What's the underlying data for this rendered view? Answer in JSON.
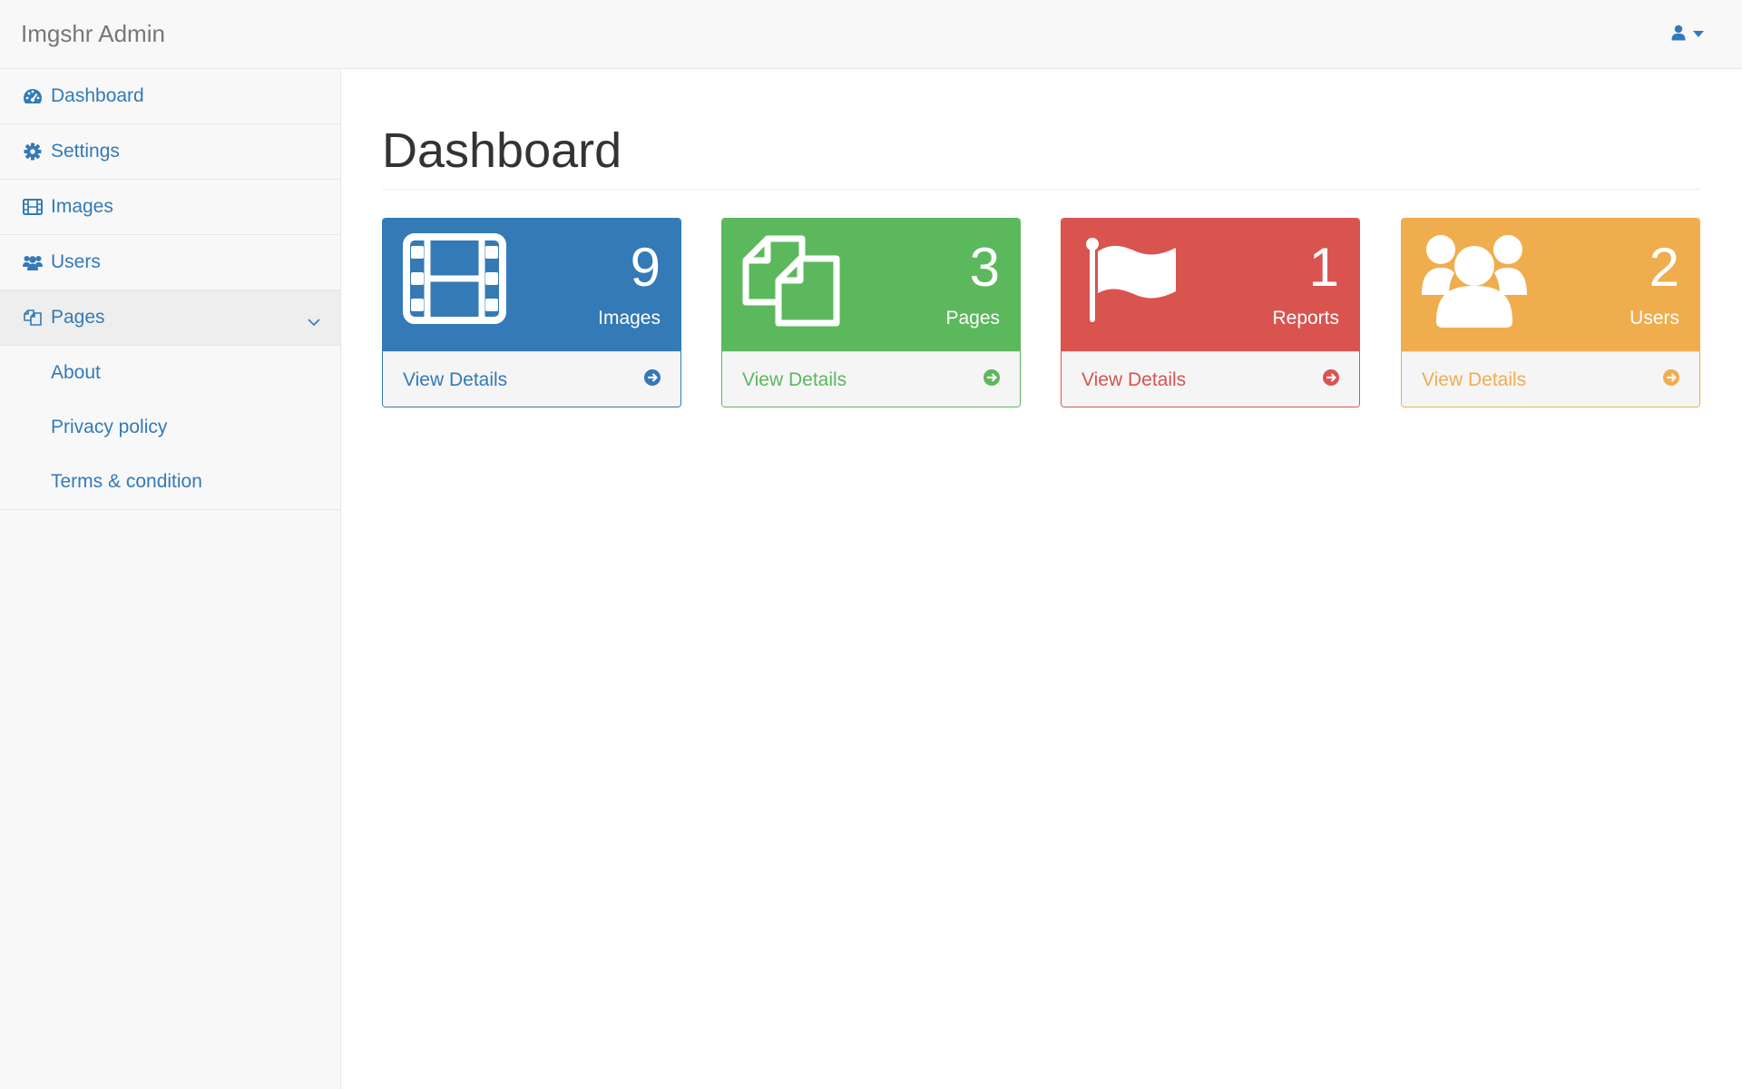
{
  "navbar": {
    "brand": "Imgshr Admin",
    "user_icon": "user-icon",
    "caret_icon": "caret-down-icon"
  },
  "sidebar": {
    "items": [
      {
        "label": "Dashboard",
        "icon": "dashboard-icon"
      },
      {
        "label": "Settings",
        "icon": "gear-icon"
      },
      {
        "label": "Images",
        "icon": "film-icon"
      },
      {
        "label": "Users",
        "icon": "users-icon"
      },
      {
        "label": "Pages",
        "icon": "pages-icon",
        "expanded": true
      }
    ],
    "sub_items": [
      {
        "label": "About"
      },
      {
        "label": "Privacy policy"
      },
      {
        "label": "Terms & condition"
      }
    ]
  },
  "main": {
    "title": "Dashboard",
    "panels": [
      {
        "count": "9",
        "label": "Images",
        "link": "View Details",
        "color": "#337ab7",
        "icon": "film-icon"
      },
      {
        "count": "3",
        "label": "Pages",
        "link": "View Details",
        "color": "#5cb85c",
        "icon": "copy-icon"
      },
      {
        "count": "1",
        "label": "Reports",
        "link": "View Details",
        "color": "#d9534f",
        "icon": "flag-icon"
      },
      {
        "count": "2",
        "label": "Users",
        "link": "View Details",
        "color": "#f0ad4e",
        "icon": "users-icon"
      }
    ]
  }
}
